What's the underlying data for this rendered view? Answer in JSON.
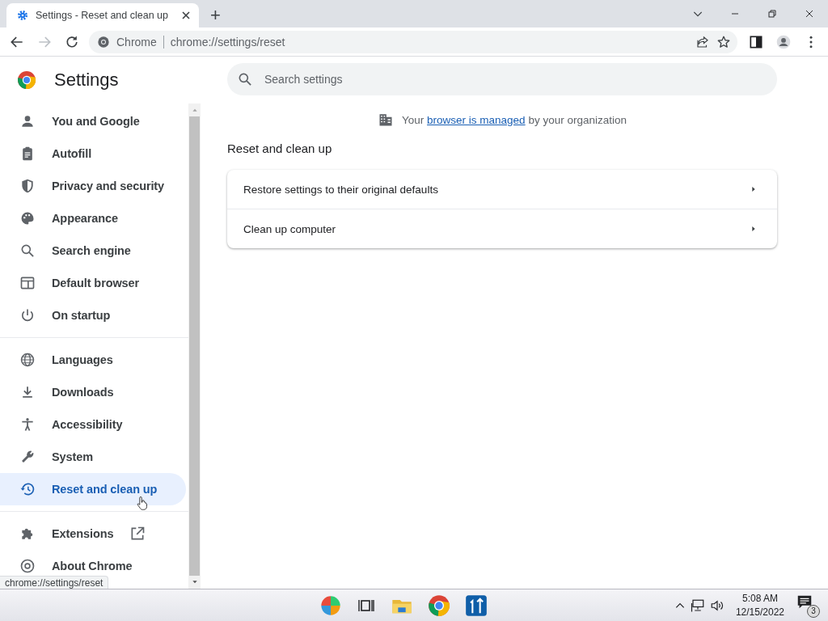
{
  "browser": {
    "tab": {
      "title": "Settings - Reset and clean up",
      "selected": true
    },
    "new_tab": "+",
    "omnibox": {
      "site": "Chrome",
      "url": "chrome://settings/reset"
    }
  },
  "sidebar": {
    "title": "Settings",
    "sections": [
      [
        {
          "label": "You and Google",
          "selected": false
        },
        {
          "label": "Autofill",
          "selected": false
        },
        {
          "label": "Privacy and security",
          "selected": false
        },
        {
          "label": "Appearance",
          "selected": false
        },
        {
          "label": "Search engine",
          "selected": false
        },
        {
          "label": "Default browser",
          "selected": false
        },
        {
          "label": "On startup",
          "selected": false
        }
      ],
      [
        {
          "label": "Languages",
          "selected": false
        },
        {
          "label": "Downloads",
          "selected": false
        },
        {
          "label": "Accessibility",
          "selected": false
        },
        {
          "label": "System",
          "selected": false
        },
        {
          "label": "Reset and clean up",
          "selected": true
        }
      ],
      [
        {
          "label": "Extensions",
          "selected": false,
          "external": true
        },
        {
          "label": "About Chrome",
          "selected": false
        }
      ]
    ]
  },
  "main": {
    "search": {
      "placeholder": "Search settings"
    },
    "managed_notice": {
      "before": "Your",
      "link": "browser is managed",
      "after": "by your organization"
    },
    "section_title": "Reset and clean up",
    "rows": [
      {
        "label": "Restore settings to their original defaults"
      },
      {
        "label": "Clean up computer"
      }
    ]
  },
  "status_bubble": "chrome://settings/reset",
  "taskbar": {
    "time": "5:08 AM",
    "date": "12/15/2022",
    "notifications": "3"
  }
}
